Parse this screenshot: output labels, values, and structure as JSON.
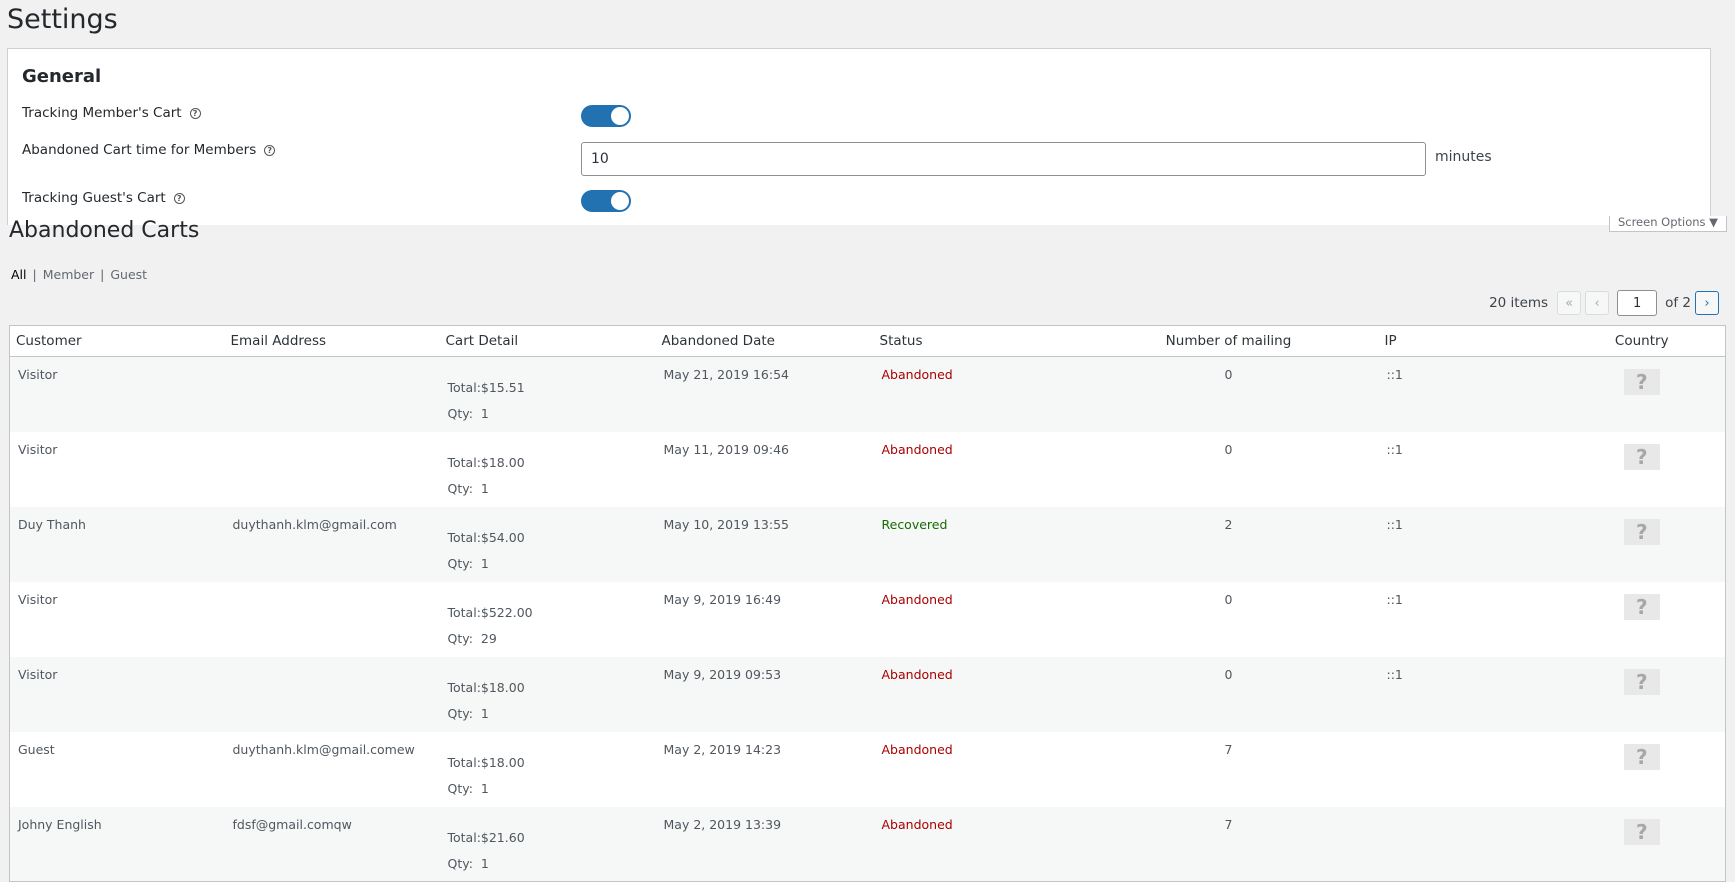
{
  "settings": {
    "title": "Settings",
    "general_title": "General",
    "tracking_member_label": "Tracking Member's Cart",
    "abandoned_time_label": "Abandoned Cart time for Members",
    "abandoned_time_value": "10",
    "minutes_label": "minutes",
    "tracking_guest_label": "Tracking Guest's Cart",
    "tracking_member_enabled": true,
    "tracking_guest_enabled": true
  },
  "abandoned": {
    "title": "Abandoned Carts",
    "screen_options": "Screen Options ▼",
    "filters": {
      "all": "All",
      "member": "Member",
      "guest": "Guest"
    },
    "pagination": {
      "count": "20 items",
      "first": "«",
      "prev": "‹",
      "current_page": "1",
      "of_pages": "of 2",
      "next": "›"
    },
    "columns": {
      "customer": "Customer",
      "email": "Email Address",
      "cart_detail": "Cart Detail",
      "date": "Abandoned Date",
      "status": "Status",
      "mailing": "Number of mailing",
      "ip": "IP",
      "country": "Country"
    },
    "rows": [
      {
        "customer": "Visitor",
        "email": "",
        "total": "Total:$15.51",
        "qty_label": "Qty:",
        "qty": "1",
        "date": "May 21, 2019 16:54",
        "status": "Abandoned",
        "mailing": "0",
        "ip": "::1",
        "country": "?"
      },
      {
        "customer": "Visitor",
        "email": "",
        "total": "Total:$18.00",
        "qty_label": "Qty:",
        "qty": "1",
        "date": "May 11, 2019 09:46",
        "status": "Abandoned",
        "mailing": "0",
        "ip": "::1",
        "country": "?"
      },
      {
        "customer": "Duy Thanh",
        "email": "duythanh.klm@gmail.com",
        "total": "Total:$54.00",
        "qty_label": "Qty:",
        "qty": "1",
        "date": "May 10, 2019 13:55",
        "status": "Recovered",
        "mailing": "2",
        "ip": "::1",
        "country": "?"
      },
      {
        "customer": "Visitor",
        "email": "",
        "total": "Total:$522.00",
        "qty_label": "Qty:",
        "qty": "29",
        "date": "May 9, 2019 16:49",
        "status": "Abandoned",
        "mailing": "0",
        "ip": "::1",
        "country": "?"
      },
      {
        "customer": "Visitor",
        "email": "",
        "total": "Total:$18.00",
        "qty_label": "Qty:",
        "qty": "1",
        "date": "May 9, 2019 09:53",
        "status": "Abandoned",
        "mailing": "0",
        "ip": "::1",
        "country": "?"
      },
      {
        "customer": "Guest",
        "email": "duythanh.klm@gmail.comew",
        "total": "Total:$18.00",
        "qty_label": "Qty:",
        "qty": "1",
        "date": "May 2, 2019 14:23",
        "status": "Abandoned",
        "mailing": "7",
        "ip": "",
        "country": "?"
      },
      {
        "customer": "Johny English",
        "email": "fdsf@gmail.comqw",
        "total": "Total:$21.60",
        "qty_label": "Qty:",
        "qty": "1",
        "date": "May 2, 2019 13:39",
        "status": "Abandoned",
        "mailing": "7",
        "ip": "",
        "country": "?"
      }
    ]
  },
  "colors": {
    "toggle_on": "#2271b1",
    "abandoned": "#aa0000",
    "recovered": "#156b00"
  }
}
